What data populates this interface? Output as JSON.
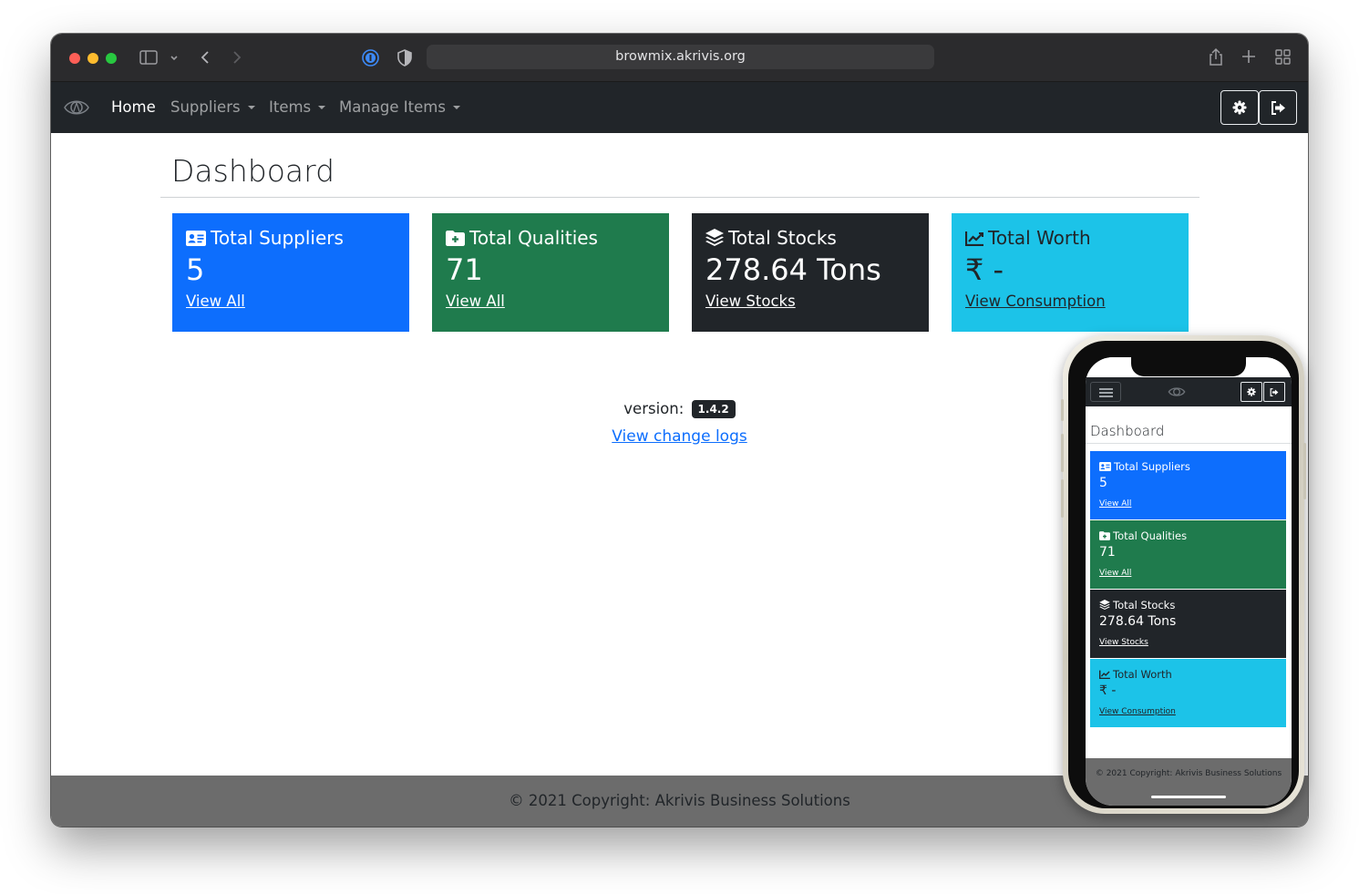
{
  "browser": {
    "url": "browmix.akrivis.org"
  },
  "navbar": {
    "home": "Home",
    "suppliers": "Suppliers",
    "items": "Items",
    "manage_items": "Manage Items"
  },
  "dashboard": {
    "title": "Dashboard",
    "cards": [
      {
        "title": "Total Suppliers",
        "value": "5",
        "link": "View All",
        "color": "#0d6efd",
        "icon": "address-card-icon"
      },
      {
        "title": "Total Qualities",
        "value": "71",
        "link": "View All",
        "color": "#1f7b4d",
        "icon": "folder-plus-icon"
      },
      {
        "title": "Total Stocks",
        "value": "278.64 Tons",
        "link": "View Stocks",
        "color": "#212529",
        "icon": "layers-icon"
      },
      {
        "title": "Total Worth",
        "value": "₹ -",
        "link": "View Consumption",
        "color": "#1cc3e8",
        "icon": "chart-line-icon"
      }
    ],
    "version_label": "version:",
    "version": "1.4.2",
    "changelog_link": "View change logs"
  },
  "footer": {
    "text": "© 2021 Copyright: Akrivis Business Solutions"
  },
  "mobile": {
    "title": "Dashboard",
    "footer": "© 2021 Copyright: Akrivis Business Solutions"
  }
}
